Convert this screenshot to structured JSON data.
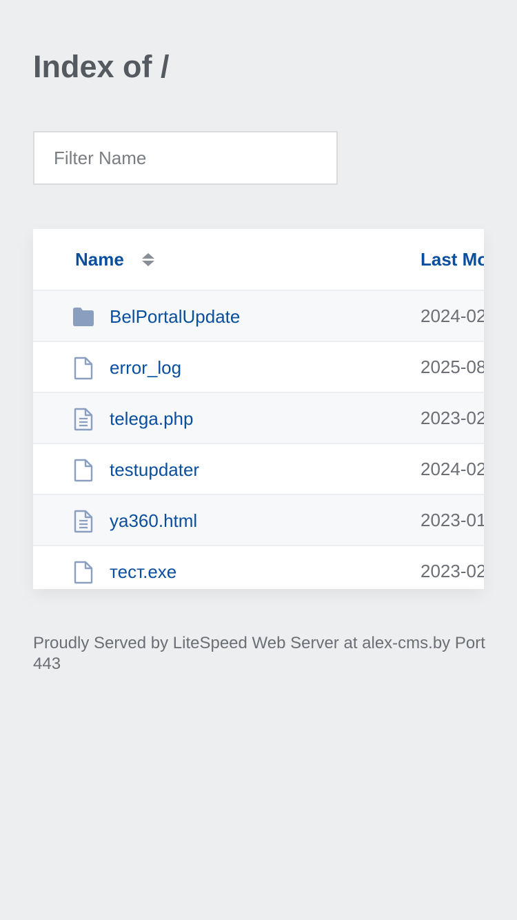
{
  "title": "Index of /",
  "filter": {
    "placeholder": "Filter Name"
  },
  "table": {
    "headers": {
      "name": "Name",
      "modified": "Last Mo"
    },
    "rows": [
      {
        "icon": "folder-icon",
        "name": "BelPortalUpdate",
        "date": "2024-02"
      },
      {
        "icon": "file-icon",
        "name": "error_log",
        "date": "2025-08"
      },
      {
        "icon": "text-file-icon",
        "name": "telega.php",
        "date": "2023-02"
      },
      {
        "icon": "file-icon",
        "name": "testupdater",
        "date": "2024-02"
      },
      {
        "icon": "text-file-icon",
        "name": "ya360.html",
        "date": "2023-01"
      },
      {
        "icon": "file-icon",
        "name": "тест.exe",
        "date": "2023-02"
      }
    ]
  },
  "footer": {
    "text": "Proudly Served by LiteSpeed Web Server at alex-cms.by Port 443"
  },
  "colors": {
    "background": "#edeef0",
    "link": "#0a4e9e",
    "icon": "#8a9fc0",
    "muted_text": "#6b6f75"
  }
}
